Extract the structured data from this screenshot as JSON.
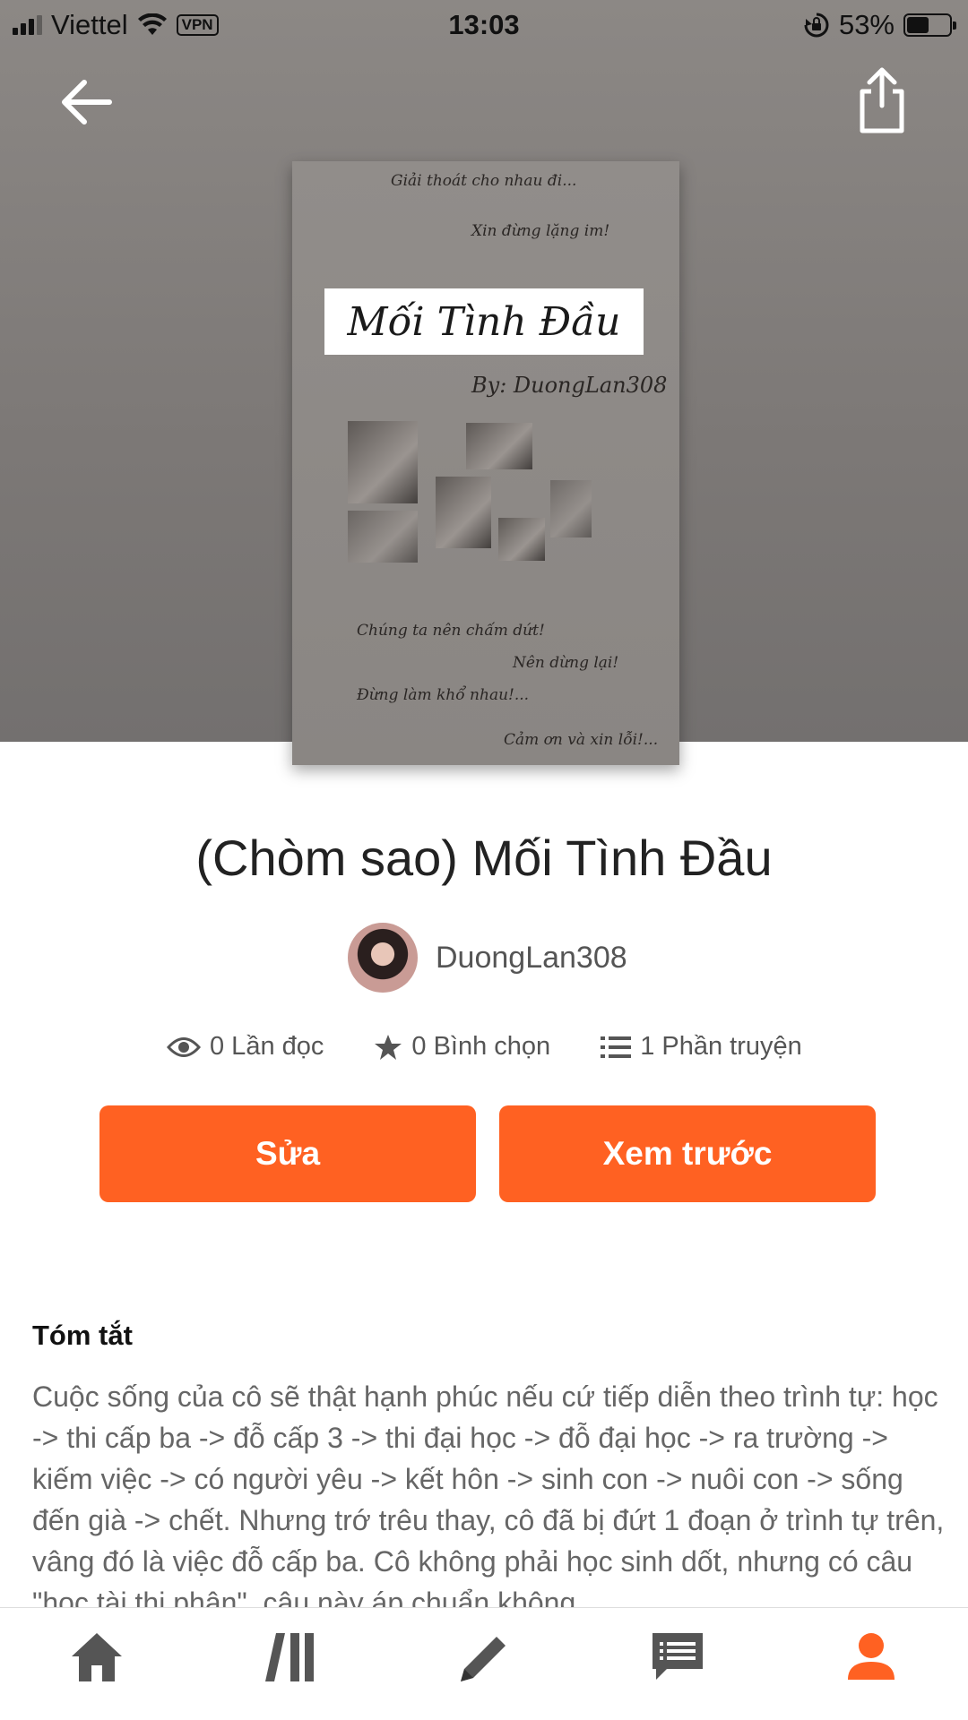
{
  "status_bar": {
    "carrier": "Viettel",
    "vpn": "VPN",
    "time": "13:03",
    "battery": "53%",
    "battery_level": 0.53
  },
  "cover": {
    "line1": "Giải thoát cho nhau đi...",
    "line2": "Xin đừng lặng im!",
    "title": "Mối Tình Đầu",
    "byline": "By: DuongLan308",
    "line3": "Chúng ta nên chấm dứt!",
    "line4": "Nên dừng lại!",
    "line5": "Đừng làm khổ nhau!...",
    "line6": "Cảm ơn và xin lỗi!..."
  },
  "story": {
    "title": "(Chòm sao) Mối Tình Đầu",
    "author": "DuongLan308"
  },
  "stats": {
    "reads": "0 Lần đọc",
    "votes": "0 Bình chọn",
    "parts": "1 Phần truyện"
  },
  "buttons": {
    "edit": "Sửa",
    "preview": "Xem trước"
  },
  "summary": {
    "heading": "Tóm tắt",
    "text": "Cuộc sống  của cô sẽ thật hạnh phúc nếu cứ tiếp diễn theo trình tự: học -> thi cấp ba -> đỗ cấp 3 -> thi đại học -> đỗ đại học -> ra trường -> kiếm việc -> có người yêu -> kết hôn -> sinh con -> nuôi con -> sống đến già -> chết. Nhưng trớ trêu thay, cô đã bị đứt 1 đoạn ở trình tự trên, vâng đó là việc đỗ cấp ba. Cô không phải học sinh dốt, nhưng có câu \"học tài thi phận\", câu này áp chuẩn không"
  },
  "tabs": [
    {
      "icon": "home-icon"
    },
    {
      "icon": "library-icon"
    },
    {
      "icon": "write-icon"
    },
    {
      "icon": "messages-icon"
    },
    {
      "icon": "profile-icon",
      "active": true
    }
  ],
  "colors": {
    "accent": "#ff6122",
    "icon_inactive": "#555555"
  }
}
